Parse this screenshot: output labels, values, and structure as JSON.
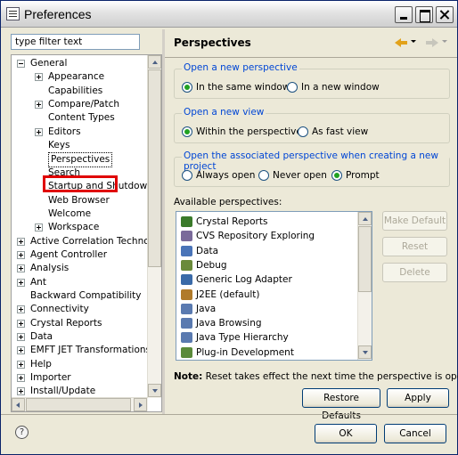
{
  "window": {
    "title": "Preferences"
  },
  "filter": {
    "value": "type filter text"
  },
  "tree": [
    {
      "label": "General",
      "level": 0,
      "expander": "minus"
    },
    {
      "label": "Appearance",
      "level": 1,
      "expander": "plus"
    },
    {
      "label": "Capabilities",
      "level": 1,
      "expander": ""
    },
    {
      "label": "Compare/Patch",
      "level": 1,
      "expander": "plus"
    },
    {
      "label": "Content Types",
      "level": 1,
      "expander": ""
    },
    {
      "label": "Editors",
      "level": 1,
      "expander": "plus"
    },
    {
      "label": "Keys",
      "level": 1,
      "expander": ""
    },
    {
      "label": "Perspectives",
      "level": 1,
      "expander": "",
      "selected": true
    },
    {
      "label": "Search",
      "level": 1,
      "expander": ""
    },
    {
      "label": "Startup and Shutdown",
      "level": 1,
      "expander": ""
    },
    {
      "label": "Web Browser",
      "level": 1,
      "expander": ""
    },
    {
      "label": "Welcome",
      "level": 1,
      "expander": ""
    },
    {
      "label": "Workspace",
      "level": 1,
      "expander": "plus"
    },
    {
      "label": "Active Correlation Technology",
      "level": 0,
      "expander": "plus"
    },
    {
      "label": "Agent Controller",
      "level": 0,
      "expander": "plus"
    },
    {
      "label": "Analysis",
      "level": 0,
      "expander": "plus"
    },
    {
      "label": "Ant",
      "level": 0,
      "expander": "plus"
    },
    {
      "label": "Backward Compatibility",
      "level": 0,
      "expander": ""
    },
    {
      "label": "Connectivity",
      "level": 0,
      "expander": "plus"
    },
    {
      "label": "Crystal Reports",
      "level": 0,
      "expander": "plus"
    },
    {
      "label": "Data",
      "level": 0,
      "expander": "plus"
    },
    {
      "label": "EMFT JET Transformations",
      "level": 0,
      "expander": "plus"
    },
    {
      "label": "Help",
      "level": 0,
      "expander": "plus"
    },
    {
      "label": "Importer",
      "level": 0,
      "expander": "plus"
    },
    {
      "label": "Install/Update",
      "level": 0,
      "expander": "plus"
    }
  ],
  "page": {
    "title": "Perspectives",
    "group_open_perspective": {
      "title": "Open a new perspective",
      "options": [
        "In the same window",
        "In a new window"
      ],
      "selected": 0
    },
    "group_open_view": {
      "title": "Open a new view",
      "options": [
        "Within the perspective",
        "As fast view"
      ],
      "selected": 0
    },
    "group_project": {
      "title": "Open the associated perspective when creating a new project",
      "options": [
        "Always open",
        "Never open",
        "Prompt"
      ],
      "selected": 2
    },
    "available_label": "Available perspectives:",
    "perspectives": [
      {
        "label": "Crystal Reports",
        "icon": "crystal-reports-icon",
        "color": "#3a7a2a"
      },
      {
        "label": "CVS Repository Exploring",
        "icon": "cvs-icon",
        "color": "#7a6a9a"
      },
      {
        "label": "Data",
        "icon": "data-icon",
        "color": "#4a74b8"
      },
      {
        "label": "Debug",
        "icon": "debug-icon",
        "color": "#6a8a3a"
      },
      {
        "label": "Generic Log Adapter",
        "icon": "log-adapter-icon",
        "color": "#3a6aa8"
      },
      {
        "label": "J2EE (default)",
        "icon": "j2ee-icon",
        "color": "#b07a2a"
      },
      {
        "label": "Java",
        "icon": "java-icon",
        "color": "#5a7ab0"
      },
      {
        "label": "Java Browsing",
        "icon": "java-browsing-icon",
        "color": "#5a7ab0"
      },
      {
        "label": "Java Type Hierarchy",
        "icon": "java-hierarchy-icon",
        "color": "#5a7ab0"
      },
      {
        "label": "Plug-in Development",
        "icon": "plugin-icon",
        "color": "#5a8a3a"
      }
    ],
    "side_buttons": {
      "make_default": "Make Default",
      "reset": "Reset",
      "delete": "Delete"
    },
    "note_bold": "Note:",
    "note_text": " Reset takes effect the next time the perspective is opened",
    "restore_defaults": "Restore Defaults",
    "apply": "Apply"
  },
  "footer": {
    "ok": "OK",
    "cancel": "Cancel"
  },
  "colors": {
    "group_title": "#0046d5",
    "highlight": "#e00000",
    "radio_selected": "#21a121"
  }
}
